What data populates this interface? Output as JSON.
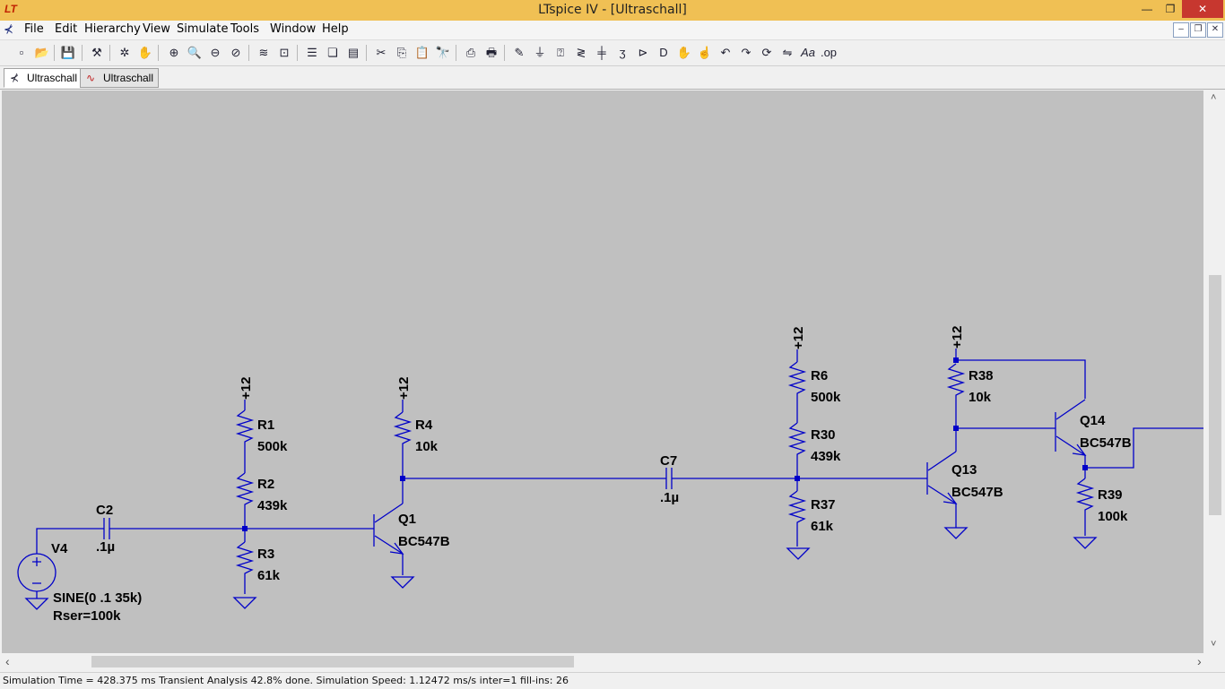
{
  "window": {
    "title": "LTspice IV - [Ultraschall]",
    "app_icon": "ltspice-logo-icon",
    "minimize_label": "—",
    "restore_label": "❐",
    "close_label": "✕",
    "close_bg": "#c7372f"
  },
  "menu": {
    "items": [
      "File",
      "Edit",
      "Hierarchy",
      "View",
      "Simulate",
      "Tools",
      "Window",
      "Help"
    ],
    "mdi_minimize": "–",
    "mdi_restore": "❐",
    "mdi_close": "✕"
  },
  "toolbar": {
    "icons": [
      "new-schematic-icon",
      "open-icon",
      "save-icon",
      "control-panel-icon",
      "run-icon",
      "pan-hand-icon",
      "zoom-in-icon",
      "zoom-area-icon",
      "zoom-out-icon",
      "zoom-cancel-icon",
      "autorange-icon",
      "zoom-fit-icon",
      "tile-horizontal-icon",
      "cascade-icon",
      "tile-vertical-icon",
      "cut-icon",
      "copy-icon",
      "paste-icon",
      "find-icon",
      "print-preview-icon",
      "print-icon",
      "draw-wire-icon",
      "ground-icon",
      "label-net-icon",
      "resistor-icon",
      "capacitor-icon",
      "inductor-icon",
      "diode-icon",
      "component-icon",
      "move-icon",
      "drag-icon",
      "undo-icon",
      "redo-icon",
      "rotate-icon",
      "mirror-icon",
      "text-icon",
      "spice-directive-icon"
    ]
  },
  "tabs": [
    {
      "label": "Ultraschall",
      "icon": "schematic-icon",
      "active": true
    },
    {
      "label": "Ultraschall",
      "icon": "waveform-icon",
      "active": false
    }
  ],
  "schematic": {
    "wire_color": "#0000c8",
    "supply": "+12",
    "components": {
      "R1": {
        "name": "R1",
        "value": "500k"
      },
      "R2": {
        "name": "R2",
        "value": "439k"
      },
      "R3": {
        "name": "R3",
        "value": "61k"
      },
      "R4": {
        "name": "R4",
        "value": "10k"
      },
      "R6": {
        "name": "R6",
        "value": "500k"
      },
      "R30": {
        "name": "R30",
        "value": "439k"
      },
      "R37": {
        "name": "R37",
        "value": "61k"
      },
      "R38": {
        "name": "R38",
        "value": "10k"
      },
      "R39": {
        "name": "R39",
        "value": "100k"
      },
      "C2": {
        "name": "C2",
        "value": ".1µ"
      },
      "C7": {
        "name": "C7",
        "value": ".1µ"
      },
      "Q1": {
        "name": "Q1",
        "value": "BC547B"
      },
      "Q13": {
        "name": "Q13",
        "value": "BC547B"
      },
      "Q14": {
        "name": "Q14",
        "value": "BC547B"
      },
      "V4": {
        "name": "V4",
        "value": "SINE(0 .1 35k)",
        "extra": "Rser=100k"
      }
    }
  },
  "status": {
    "text": "Simulation Time = 428.375 ms  Transient Analysis 42.8% done. Simulation Speed: 1.12472 ms/s inter=1 fill-ins: 26"
  },
  "scroll": {
    "left_arrow": "‹",
    "right_arrow": "›",
    "up_arrow": "˄",
    "down_arrow": "˅"
  }
}
